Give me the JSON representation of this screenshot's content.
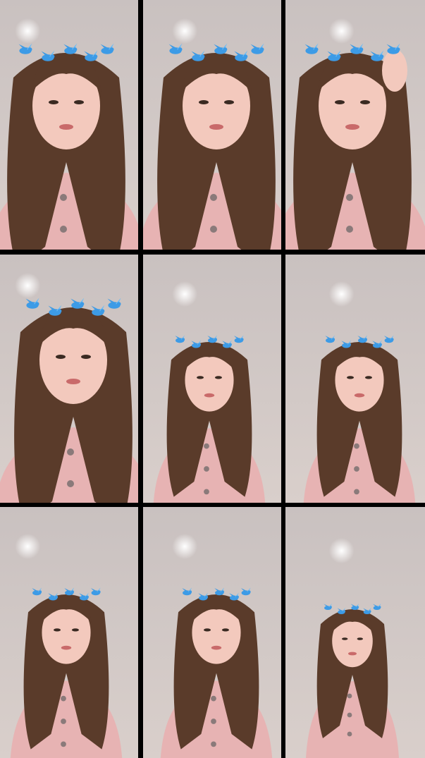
{
  "collage": {
    "tiles": [
      {
        "id": "frame-1",
        "scene": "close-up",
        "bird_crown": true,
        "hand_in_hair": false
      },
      {
        "id": "frame-2",
        "scene": "close-up",
        "bird_crown": true,
        "hand_in_hair": false
      },
      {
        "id": "frame-3",
        "scene": "close-up",
        "bird_crown": true,
        "hand_in_hair": true
      },
      {
        "id": "frame-4",
        "scene": "close-up",
        "bird_crown": true,
        "hand_in_hair": false
      },
      {
        "id": "frame-5",
        "scene": "medium",
        "bird_crown": true,
        "hand_in_hair": false
      },
      {
        "id": "frame-6",
        "scene": "medium",
        "bird_crown": true,
        "hand_in_hair": false
      },
      {
        "id": "frame-7",
        "scene": "medium",
        "bird_crown": true,
        "hand_in_hair": false
      },
      {
        "id": "frame-8",
        "scene": "medium",
        "bird_crown": true,
        "hand_in_hair": false
      },
      {
        "id": "frame-9",
        "scene": "wide",
        "bird_crown": true,
        "hand_in_hair": false
      }
    ],
    "colors": {
      "background": "#000000",
      "wall": "#d9cfcb",
      "ceiling_light": "#ffffff",
      "hair": "#5a3b2a",
      "skin": "#f3c9bd",
      "pajamas": "#e7b3b3",
      "birds": "#3d9be6",
      "lips": "#c96a6a"
    }
  }
}
